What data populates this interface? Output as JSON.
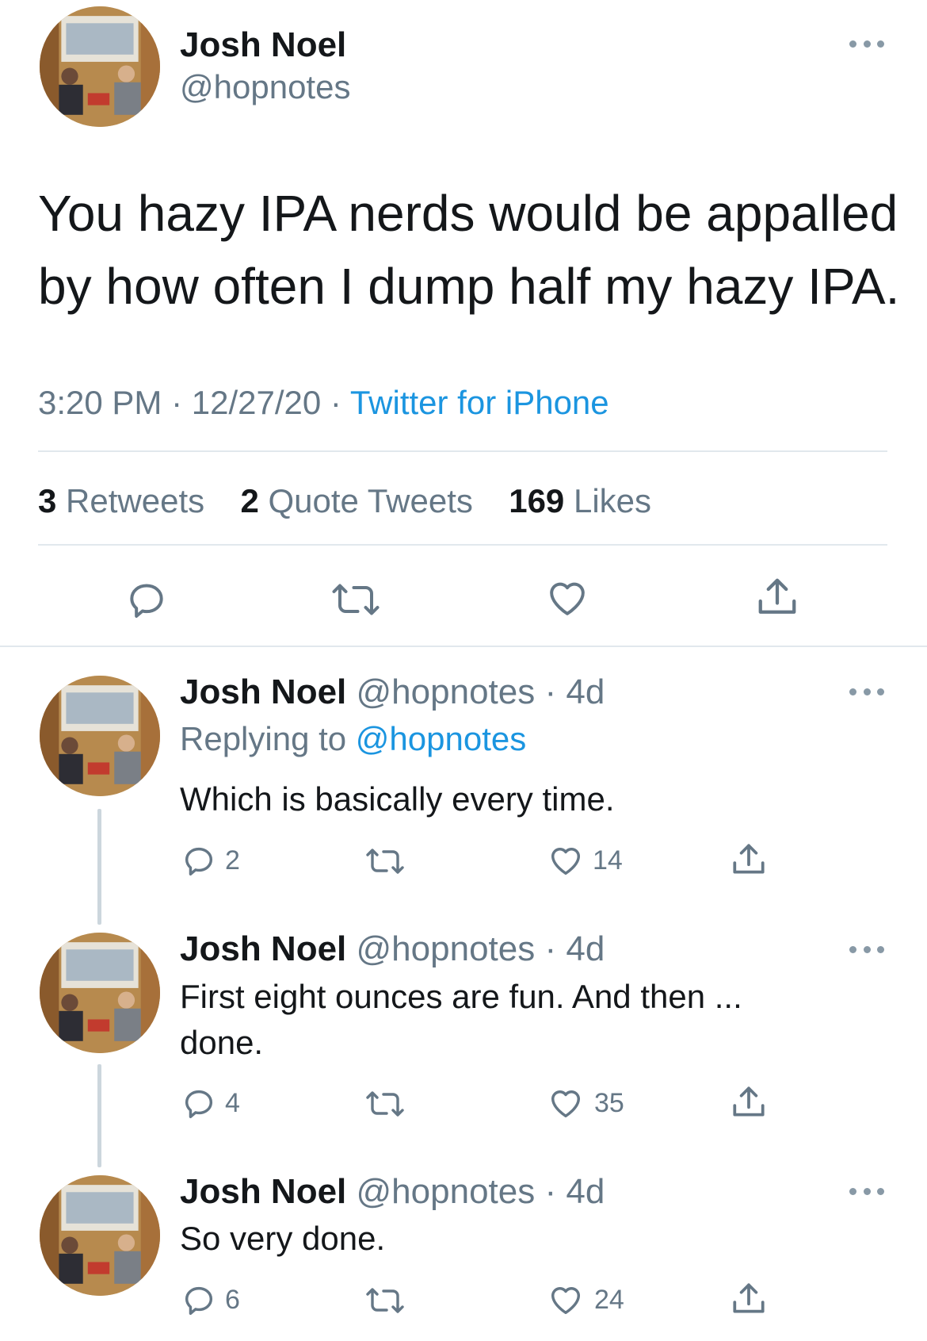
{
  "main_tweet": {
    "author_name": "Josh Noel",
    "author_handle": "@hopnotes",
    "text_line1": "You hazy IPA nerds would be appalled",
    "text_line2": "by how often I dump half my hazy IPA.",
    "time": "3:20 PM",
    "date": "12/27/20",
    "source": "Twitter for iPhone",
    "stats": {
      "retweets_count": "3",
      "retweets_label": "Retweets",
      "quotes_count": "2",
      "quotes_label": "Quote Tweets",
      "likes_count": "169",
      "likes_label": "Likes"
    },
    "actions": [
      "reply-icon",
      "retweet-icon",
      "like-icon",
      "share-icon"
    ]
  },
  "replies": [
    {
      "author_name": "Josh Noel",
      "author_handle": "@hopnotes",
      "age": "4d",
      "replying_prefix": "Replying to",
      "replying_to": "@hopnotes",
      "text_line1": "Which is basically every time.",
      "reply_count": "2",
      "like_count": "14"
    },
    {
      "author_name": "Josh Noel",
      "author_handle": "@hopnotes",
      "age": "4d",
      "text_line1": "First eight ounces are fun. And then ...",
      "text_line2": "done.",
      "reply_count": "4",
      "like_count": "35"
    },
    {
      "author_name": "Josh Noel",
      "author_handle": "@hopnotes",
      "age": "4d",
      "text_line1": "So very done.",
      "reply_count": "6",
      "like_count": "24"
    }
  ],
  "colors": {
    "link": "#1b95e0",
    "muted": "#657786",
    "icon": "#657786",
    "divider": "#e1e8ed"
  }
}
